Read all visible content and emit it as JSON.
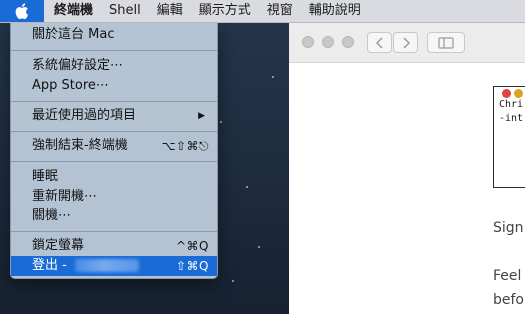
{
  "menubar": {
    "apple_icon": "apple-logo-icon",
    "app_name": "終端機",
    "items": [
      "Shell",
      "編輯",
      "顯示方式",
      "視窗",
      "輔助說明"
    ]
  },
  "apple_menu": {
    "about": "關於這台 Mac",
    "prefs": "系統偏好設定⋯",
    "app_store": "App Store⋯",
    "recent": "最近使用過的項目",
    "force_quit": "強制結束-終端機",
    "force_quit_shortcut": "⌥⇧⌘⎋",
    "sleep": "睡眠",
    "restart": "重新開機⋯",
    "shutdown": "關機⋯",
    "lock": "鎖定螢幕",
    "lock_shortcut": "^⌘Q",
    "logout": "登出 -",
    "logout_shortcut": "⇧⌘Q"
  },
  "background_window": {
    "terminal_lines": [
      "Chri",
      "-int"
    ],
    "text_lines": [
      "Sign",
      "Feel",
      "befo"
    ]
  },
  "colors": {
    "accent": "#1a6bd6",
    "menu_bg": "#bacada",
    "desktop": "#1f2c3e"
  }
}
